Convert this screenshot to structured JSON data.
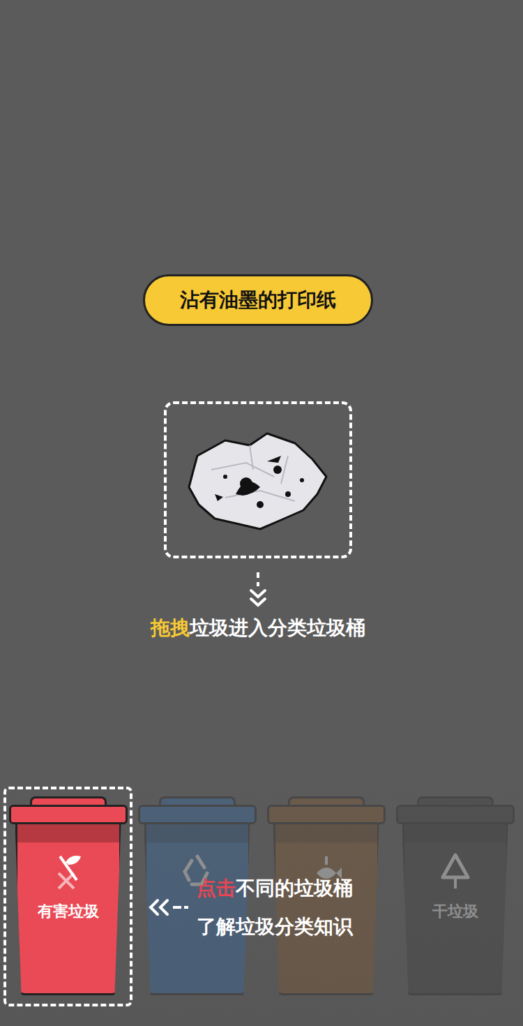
{
  "prompt": {
    "text": "沾有油墨的打印纸"
  },
  "instruction": {
    "highlight": "拖拽",
    "rest": "垃圾进入分类垃圾桶"
  },
  "bins": [
    {
      "label": "有害垃圾",
      "color": "#e94a55",
      "selected": true,
      "kind": "hazardous"
    },
    {
      "color": "#2f6db3",
      "selected": false,
      "kind": "recyclable"
    },
    {
      "color": "#8b5a2b",
      "selected": false,
      "kind": "wet"
    },
    {
      "label": "干垃圾",
      "color": "#3e3e3e",
      "selected": false,
      "kind": "dry"
    }
  ],
  "hint": {
    "highlight": "点击",
    "line1_rest": "不同的垃圾桶",
    "line2": "了解垃圾分类知识"
  }
}
